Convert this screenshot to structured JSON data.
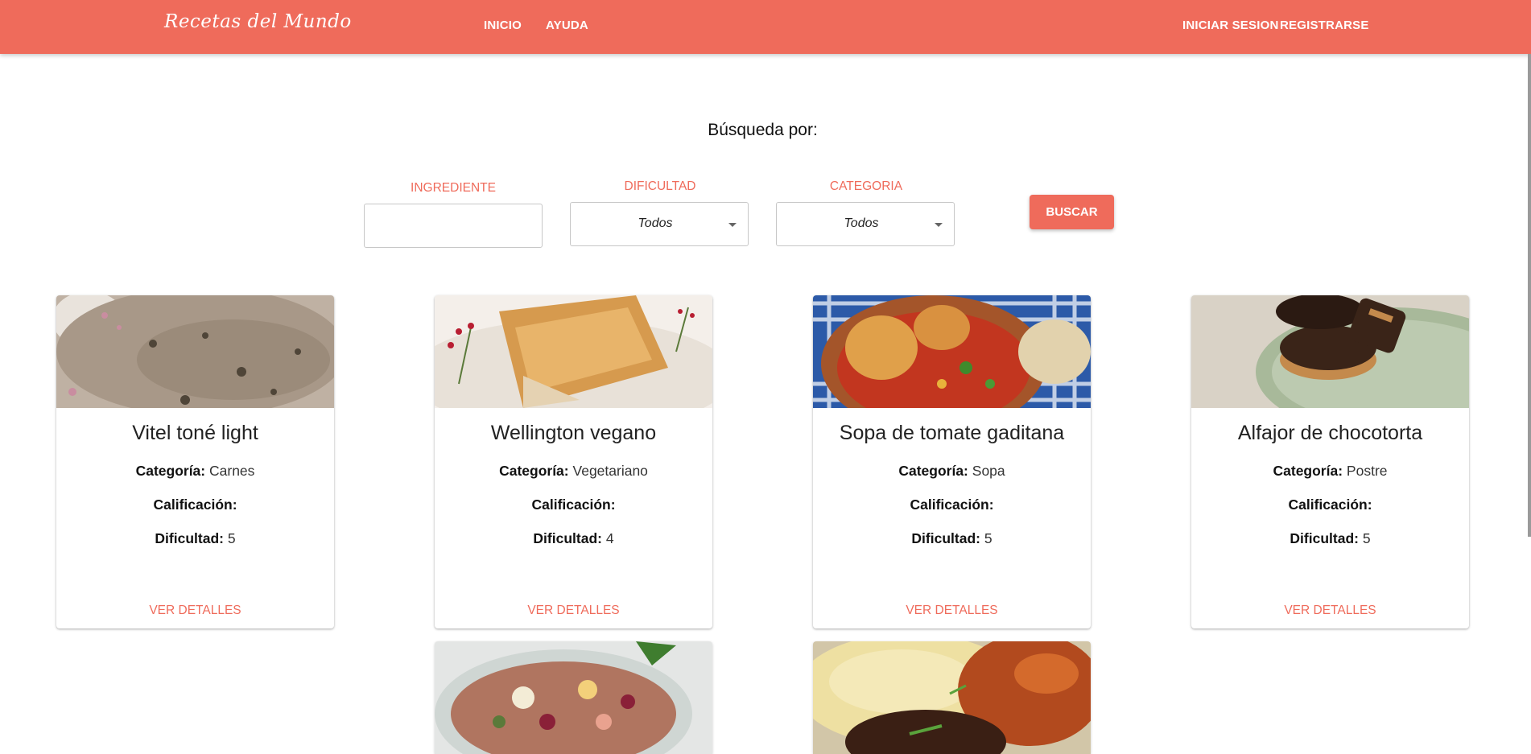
{
  "navbar": {
    "brand": "Recetas del Mundo",
    "links": [
      "INICIO",
      "AYUDA"
    ],
    "auth": [
      "INICIAR SESION",
      "REGISTRARSE"
    ]
  },
  "search": {
    "heading": "Búsqueda por:",
    "ingredient_label": "INGREDIENTE",
    "ingredient_value": "",
    "difficulty_label": "DIFICULTAD",
    "difficulty_value": "Todos",
    "category_label": "CATEGORIA",
    "category_value": "Todos",
    "button": "BUSCAR"
  },
  "labels": {
    "category": "Categoría:",
    "rating": "Calificación:",
    "difficulty": "Dificultad:",
    "details": "VER DETALLES"
  },
  "recipes": [
    {
      "title": "Vitel toné light",
      "category": "Carnes",
      "rating": "",
      "difficulty": "5",
      "image": "vitel-tone-photo"
    },
    {
      "title": "Wellington vegano",
      "category": "Vegetariano",
      "rating": "",
      "difficulty": "4",
      "image": "wellington-photo"
    },
    {
      "title": "Sopa de tomate gaditana",
      "category": "Sopa",
      "rating": "",
      "difficulty": "5",
      "image": "tomato-soup-photo"
    },
    {
      "title": "Alfajor de chocotorta",
      "category": "Postre",
      "rating": "",
      "difficulty": "5",
      "image": "alfajor-photo"
    }
  ],
  "more_cards": [
    {
      "image": "salad-photo"
    },
    {
      "image": "mashed-potato-steak-photo"
    }
  ],
  "colors": {
    "accent": "#ef6b5b"
  }
}
